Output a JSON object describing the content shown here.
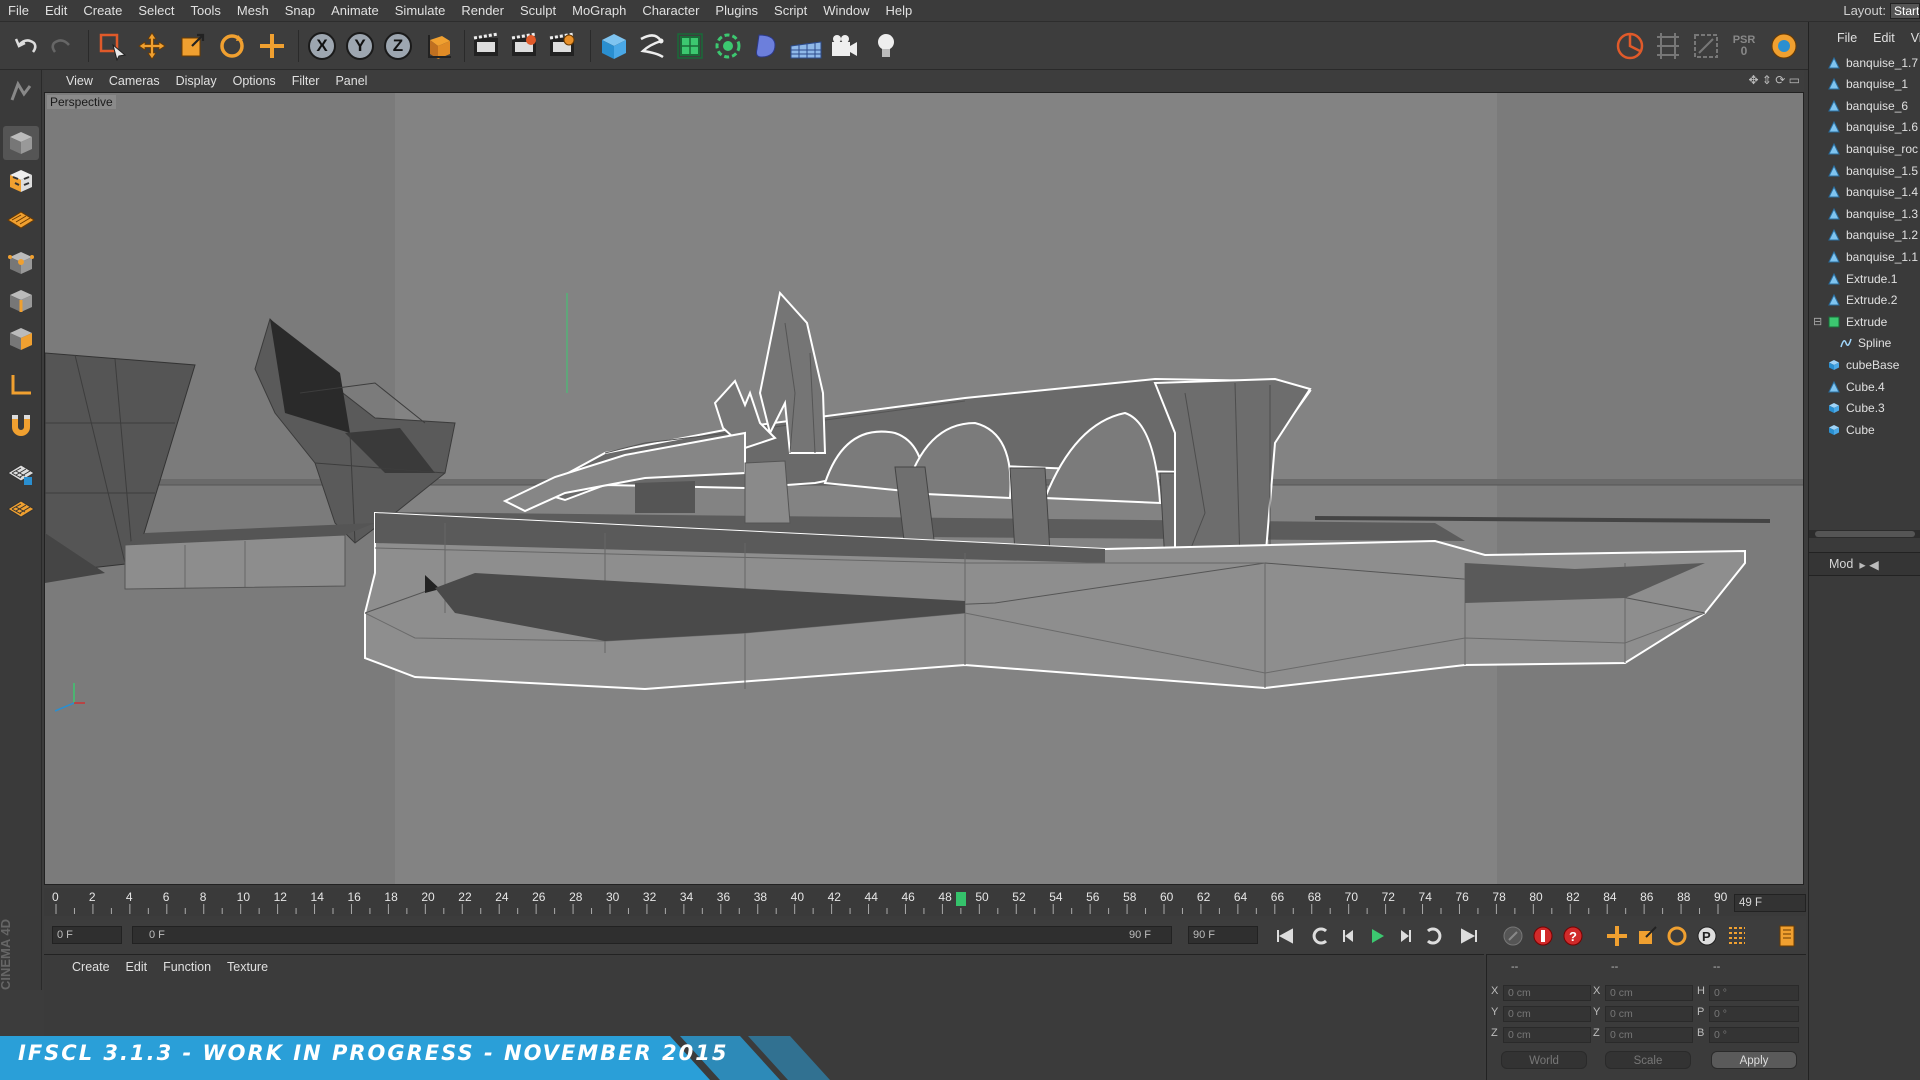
{
  "menubar": {
    "items": [
      "File",
      "Edit",
      "Create",
      "Select",
      "Tools",
      "Mesh",
      "Snap",
      "Animate",
      "Simulate",
      "Render",
      "Sculpt",
      "MoGraph",
      "Character",
      "Plugins",
      "Script",
      "Window",
      "Help"
    ],
    "layout_label": "Layout:",
    "layout_value": "Start"
  },
  "toolbar": {
    "axis_x": "X",
    "axis_y": "Y",
    "axis_z": "Z",
    "psr_label": "PSR",
    "psr_value": "0",
    "icons": [
      "undo-icon",
      "redo-icon",
      "live-selection-icon",
      "move-icon",
      "scale-icon",
      "rotate-icon",
      "coordinate-icon",
      "x-axis",
      "y-axis",
      "z-axis",
      "world-coordinate-icon",
      "render-view-icon",
      "render-picture-viewer-icon",
      "edit-render-settings-icon",
      "cube-primitive-icon",
      "spline-pen-icon",
      "subdivision-surface-icon",
      "array-icon",
      "deformer-icon",
      "floor-icon",
      "camera-icon",
      "light-icon"
    ]
  },
  "viewport": {
    "menu": [
      "View",
      "Cameras",
      "Display",
      "Options",
      "Filter",
      "Panel"
    ],
    "label": "Perspective"
  },
  "object_manager": {
    "menu": [
      "File",
      "Edit",
      "Vi"
    ],
    "objects": [
      {
        "name": "banquise_1.7",
        "type": "polygon"
      },
      {
        "name": "banquise_1",
        "type": "polygon"
      },
      {
        "name": "banquise_6",
        "type": "polygon"
      },
      {
        "name": "banquise_1.6",
        "type": "polygon"
      },
      {
        "name": "banquise_roc",
        "type": "polygon"
      },
      {
        "name": "banquise_1.5",
        "type": "polygon"
      },
      {
        "name": "banquise_1.4",
        "type": "polygon"
      },
      {
        "name": "banquise_1.3",
        "type": "polygon"
      },
      {
        "name": "banquise_1.2",
        "type": "polygon"
      },
      {
        "name": "banquise_1.1",
        "type": "polygon"
      },
      {
        "name": "Extrude.1",
        "type": "polygon"
      },
      {
        "name": "Extrude.2",
        "type": "polygon"
      },
      {
        "name": "Extrude",
        "type": "extrude"
      },
      {
        "name": "Spline",
        "type": "spline"
      },
      {
        "name": "cubeBase",
        "type": "cube"
      },
      {
        "name": "Cube.4",
        "type": "polygon"
      },
      {
        "name": "Cube.3",
        "type": "cube"
      },
      {
        "name": "Cube",
        "type": "cube"
      }
    ],
    "attr_label": "Mod"
  },
  "timeline": {
    "ticks": [
      "0",
      "2",
      "4",
      "6",
      "8",
      "10",
      "12",
      "14",
      "16",
      "18",
      "20",
      "22",
      "24",
      "26",
      "28",
      "30",
      "32",
      "34",
      "36",
      "38",
      "40",
      "42",
      "44",
      "46",
      "48",
      "50",
      "52",
      "54",
      "56",
      "58",
      "60",
      "62",
      "64",
      "66",
      "68",
      "70",
      "72",
      "74",
      "76",
      "78",
      "80",
      "82",
      "84",
      "86",
      "88",
      "90"
    ],
    "current_label": "49",
    "current_frame": 49,
    "frame_field": "49 F"
  },
  "transport": {
    "start_field": "0 F",
    "range_start": "0 F",
    "range_end": "90 F",
    "end_field": "90 F"
  },
  "material_panel": {
    "menu": [
      "Create",
      "Edit",
      "Function",
      "Texture"
    ]
  },
  "coords": {
    "header": [
      "--",
      "--",
      "--"
    ],
    "rows": [
      {
        "a": "X",
        "av": "0 cm",
        "b": "X",
        "bv": "0 cm",
        "c": "H",
        "cv": "0 °"
      },
      {
        "a": "Y",
        "av": "0 cm",
        "b": "Y",
        "bv": "0 cm",
        "c": "P",
        "cv": "0 °"
      },
      {
        "a": "Z",
        "av": "0 cm",
        "b": "Z",
        "bv": "0 cm",
        "c": "B",
        "cv": "0 °"
      }
    ],
    "mode": "World",
    "scale": "Scale",
    "apply": "Apply"
  },
  "banner": {
    "text": "IFSCL 3.1.3 - WORK IN PROGRESS - NOVEMBER 2015",
    "logo": "CINEMA 4D"
  },
  "colors": {
    "accent_blue": "#2a9fd8",
    "timeline_marker": "#35c26b",
    "viewport_bg": "#7a7a7a"
  }
}
